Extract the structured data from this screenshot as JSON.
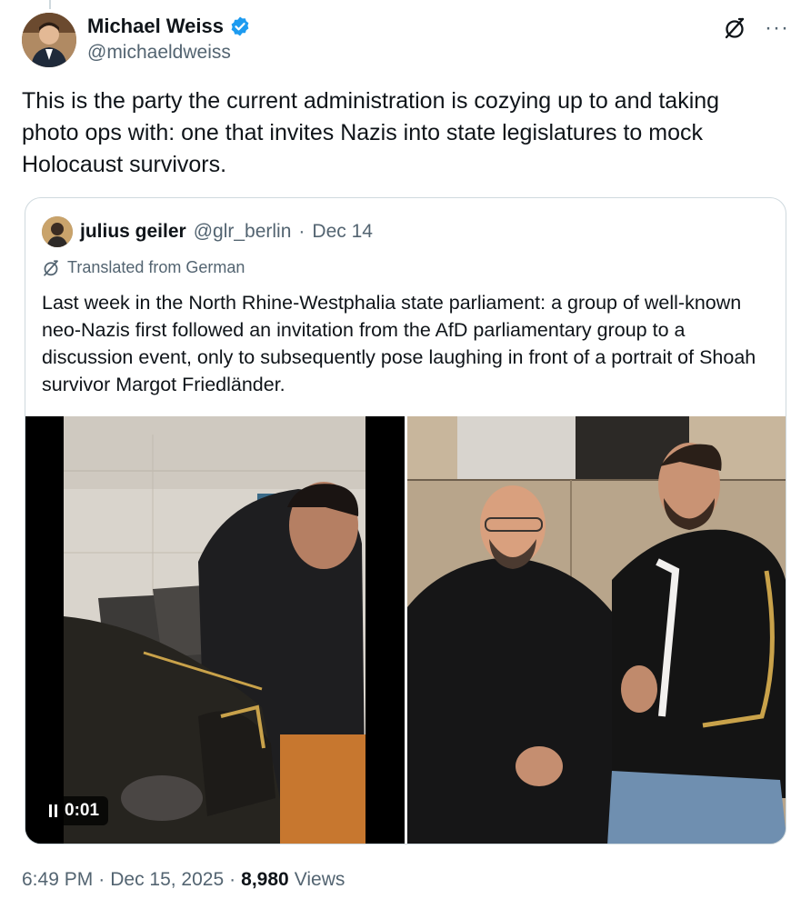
{
  "author": {
    "display_name": "Michael Weiss",
    "handle": "@michaeldweiss",
    "verified": true,
    "avatar_icon": "avatar-photo"
  },
  "tweet": {
    "text": "This is the party the current administration is cozying up to and taking photo ops with: one that invites Nazis into state legislatures to mock Holocaust survivors."
  },
  "quote": {
    "display_name": "julius geiler",
    "handle": "@glr_berlin",
    "separator": "·",
    "date": "Dec 14",
    "translated_label": "Translated from German",
    "text": "Last week in the North Rhine-Westphalia state parliament: a group of well-known neo-Nazis first followed an invitation from the AfD parliamentary group to a discussion event, only to subsequently pose laughing in front of a portrait of Shoah survivor Margot Friedländer.",
    "video_time": "0:01"
  },
  "footer": {
    "time": "6:49 PM",
    "sep1": "·",
    "date": "Dec 15, 2025",
    "sep2": "·",
    "views_count": "8,980",
    "views_label": "Views"
  },
  "colors": {
    "verified_blue": "#1d9bf0",
    "secondary_text": "#536471",
    "border": "#cfd9de"
  }
}
